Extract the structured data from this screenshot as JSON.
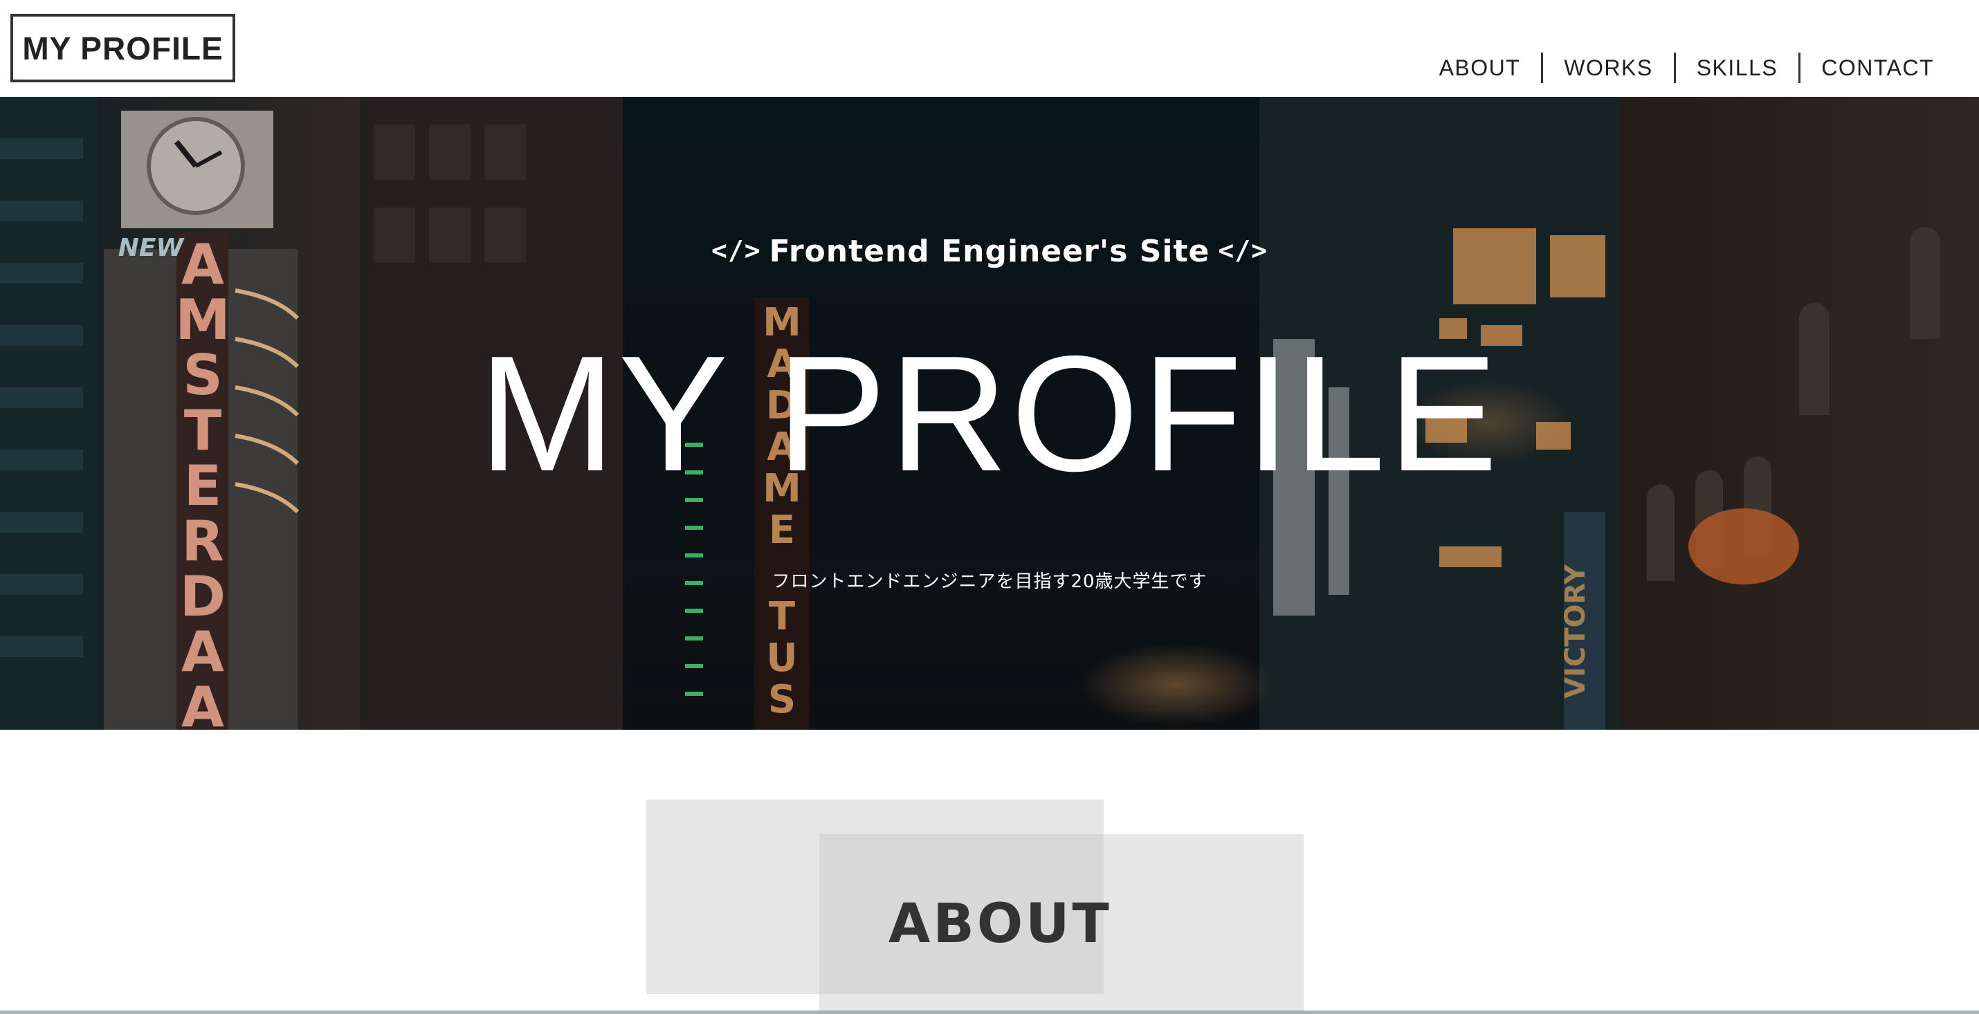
{
  "header": {
    "logo_text": "MY PROFILE",
    "nav": [
      {
        "label": "ABOUT"
      },
      {
        "label": "WORKS"
      },
      {
        "label": "SKILLS"
      },
      {
        "label": "CONTACT"
      }
    ]
  },
  "hero": {
    "tagline_icon_left": "</>",
    "tagline": "Frontend Engineer's Site",
    "tagline_icon_right": "</>",
    "title": "MY PROFILE",
    "subtitle": "フロントエンドエンジニアを目指す20歳大学生です",
    "background_image": "night-city-street-photo"
  },
  "about": {
    "title": "ABOUT"
  },
  "colors": {
    "text_dark": "#222222",
    "hero_text": "#ffffff",
    "about_box": "#d6d6d6"
  }
}
